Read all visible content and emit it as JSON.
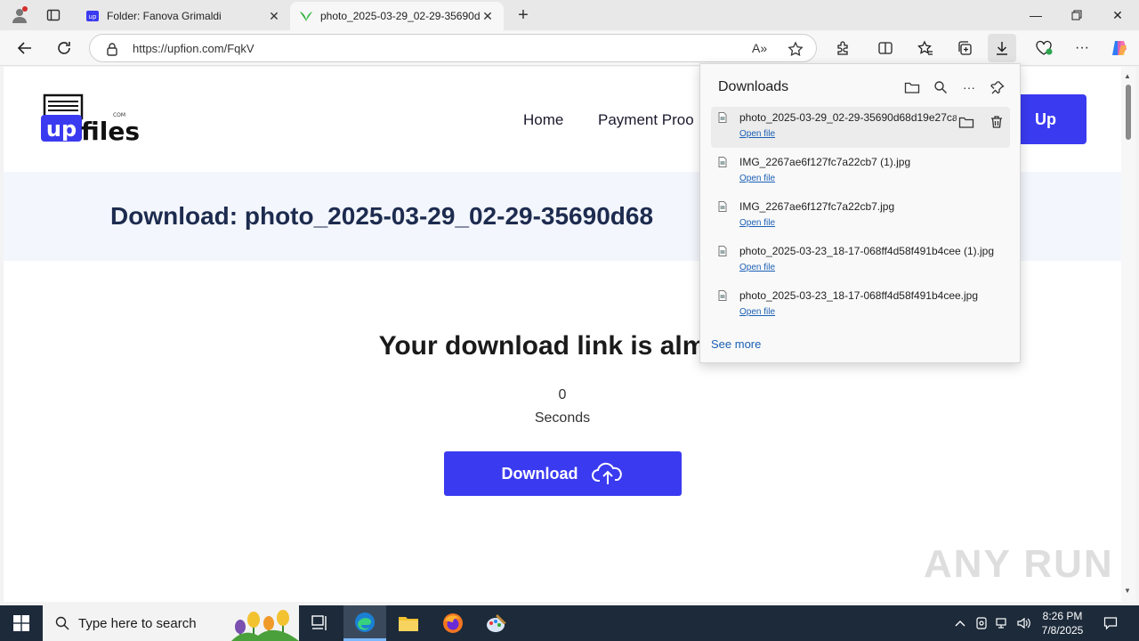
{
  "browser": {
    "tabs": [
      {
        "title": "Folder: Fanova Grimaldi",
        "active": false
      },
      {
        "title": "photo_2025-03-29_02-29-35690d",
        "active": true
      }
    ],
    "address": {
      "url": "https://upfion.com/FqkV"
    }
  },
  "site": {
    "logo_text": "files",
    "logo_prefix": "up",
    "logo_suffix": "COM",
    "nav": [
      "Home",
      "Payment Proo"
    ],
    "signup_label": "Up",
    "banner_title": "Download: photo_2025-03-29_02-29-35690d68",
    "almost_text": "Your download link is almost",
    "counter_value": "0",
    "counter_label": "Seconds",
    "download_button": "Download"
  },
  "downloads_panel": {
    "title": "Downloads",
    "items": [
      {
        "name": "photo_2025-03-29_02-29-35690d68d19e27ca",
        "action": "Open file"
      },
      {
        "name": "IMG_2267ae6f127fc7a22cb7 (1).jpg",
        "action": "Open file"
      },
      {
        "name": "IMG_2267ae6f127fc7a22cb7.jpg",
        "action": "Open file"
      },
      {
        "name": "photo_2025-03-23_18-17-068ff4d58f491b4cee (1).jpg",
        "action": "Open file"
      },
      {
        "name": "photo_2025-03-23_18-17-068ff4d58f491b4cee.jpg",
        "action": "Open file"
      }
    ],
    "see_more": "See more"
  },
  "watermark": "ANY RUN",
  "taskbar": {
    "search_placeholder": "Type here to search",
    "time": "8:26 PM",
    "date": "7/8/2025"
  },
  "colors": {
    "accent": "#3a3af0",
    "banner_bg": "#f3f6fc",
    "taskbar_bg": "#1c2a3a"
  }
}
